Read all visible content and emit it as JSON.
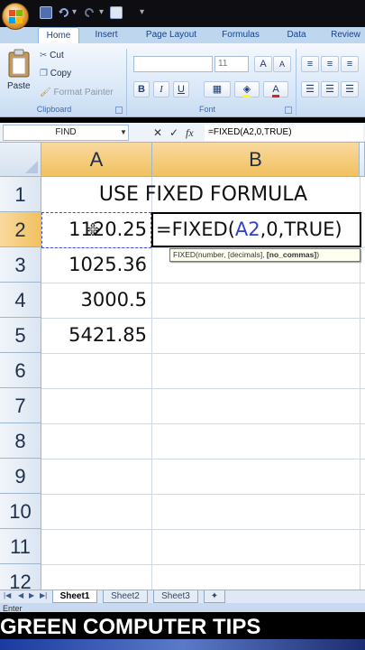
{
  "ribbon": {
    "tabs": [
      "Home",
      "Insert",
      "Page Layout",
      "Formulas",
      "Data",
      "Review"
    ],
    "clipboard": {
      "paste": "Paste",
      "cut": "Cut",
      "copy": "Copy",
      "format_painter": "Format Painter",
      "label": "Clipboard"
    },
    "font": {
      "size": "11",
      "bold": "B",
      "italic": "I",
      "underline": "U",
      "label": "Font"
    }
  },
  "formula_bar": {
    "name_box": "FIND",
    "fx": "fx",
    "formula": "=FIXED(A2,0,TRUE)"
  },
  "grid": {
    "columns": [
      "A",
      "B"
    ],
    "rows": [
      "1",
      "2",
      "3",
      "4",
      "5",
      "6",
      "7",
      "8",
      "9",
      "10",
      "11",
      "12"
    ],
    "title": "USE FIXED FORMULA",
    "values": [
      "1120.25",
      "1025.36",
      "3000.5",
      "5421.85"
    ],
    "editing": {
      "prefix": "=FIXED(",
      "ref": "A2",
      "suffix": ",0,TRUE)"
    },
    "tooltip": {
      "main": "FIXED(number, [decimals], ",
      "bold": "[no_commas]",
      "end": ")"
    }
  },
  "sheet_tabs": [
    "Sheet1",
    "Sheet2",
    "Sheet3"
  ],
  "status": "Enter",
  "caption": "GREEN COMPUTER TIPS",
  "colors": {
    "selected_header": "#f1c15f",
    "reference_blue": "#2f41c9",
    "ribbon": "#d7e6f7"
  }
}
